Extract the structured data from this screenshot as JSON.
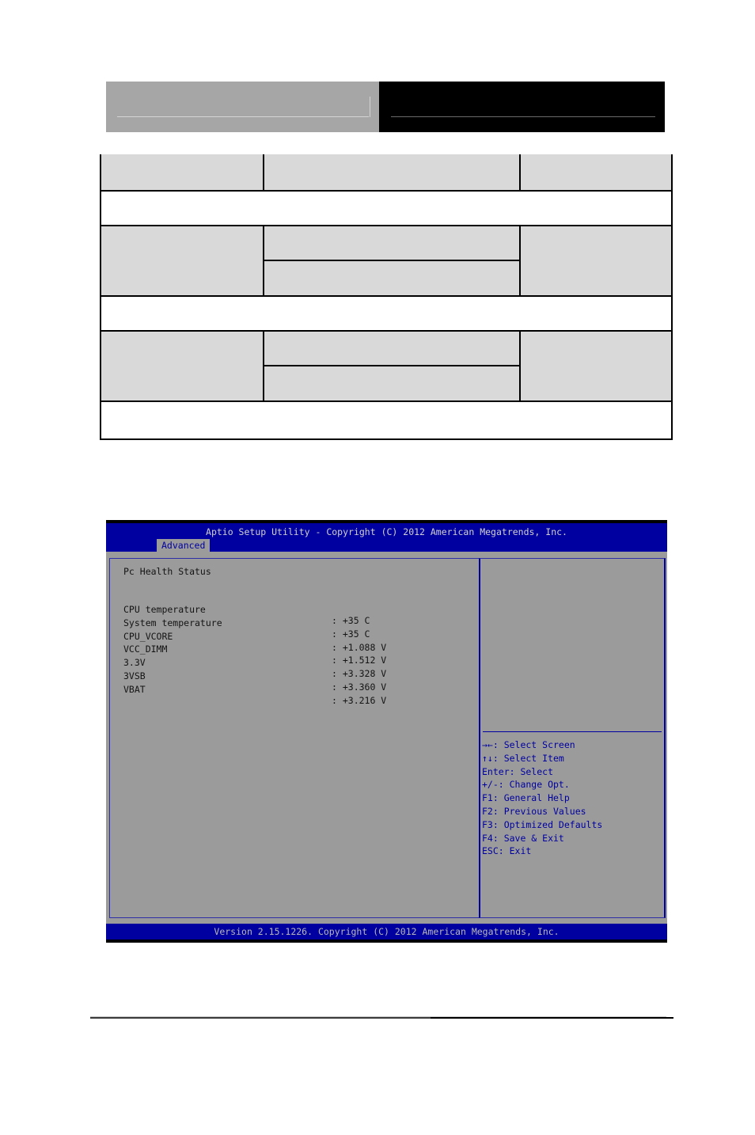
{
  "page_header": {
    "left_text": "",
    "right_text": ""
  },
  "option_table": {
    "rows": [
      {
        "cells": [
          "",
          "",
          ""
        ]
      },
      {
        "cells": [
          ""
        ]
      },
      {
        "cells": [
          "",
          "",
          ""
        ],
        "sub_cells": [
          ""
        ]
      },
      {
        "cells": [
          ""
        ]
      },
      {
        "cells": [
          "",
          "",
          ""
        ],
        "sub_cells": [
          ""
        ]
      },
      {
        "cells": [
          ""
        ]
      }
    ]
  },
  "bios": {
    "title": "Aptio Setup Utility - Copyright (C) 2012 American Megatrends, Inc.",
    "active_tab": "Advanced",
    "section_title": "Pc Health Status",
    "readings": [
      {
        "label": "CPU temperature",
        "value": ": +35 C"
      },
      {
        "label": "System temperature",
        "value": ": +35 C"
      },
      {
        "label": "CPU_VCORE",
        "value": ": +1.088 V"
      },
      {
        "label": "VCC_DIMM",
        "value": ": +1.512 V"
      },
      {
        "label": "3.3V",
        "value": ": +3.328 V"
      },
      {
        "label": "3VSB",
        "value": ": +3.360 V"
      },
      {
        "label": "VBAT",
        "value": ": +3.216 V"
      }
    ],
    "help": [
      "→←: Select Screen",
      "↑↓: Select Item",
      "Enter: Select",
      "+/-: Change Opt.",
      "F1: General Help",
      "F2: Previous Values",
      "F3: Optimized Defaults",
      "F4: Save & Exit",
      "ESC: Exit"
    ],
    "footer": "Version 2.15.1226. Copyright (C) 2012 American Megatrends, Inc.",
    "colors": {
      "bar_blue": "#0000a0",
      "panel_gray": "#9b9b9b",
      "help_text": "#0000a0"
    }
  }
}
